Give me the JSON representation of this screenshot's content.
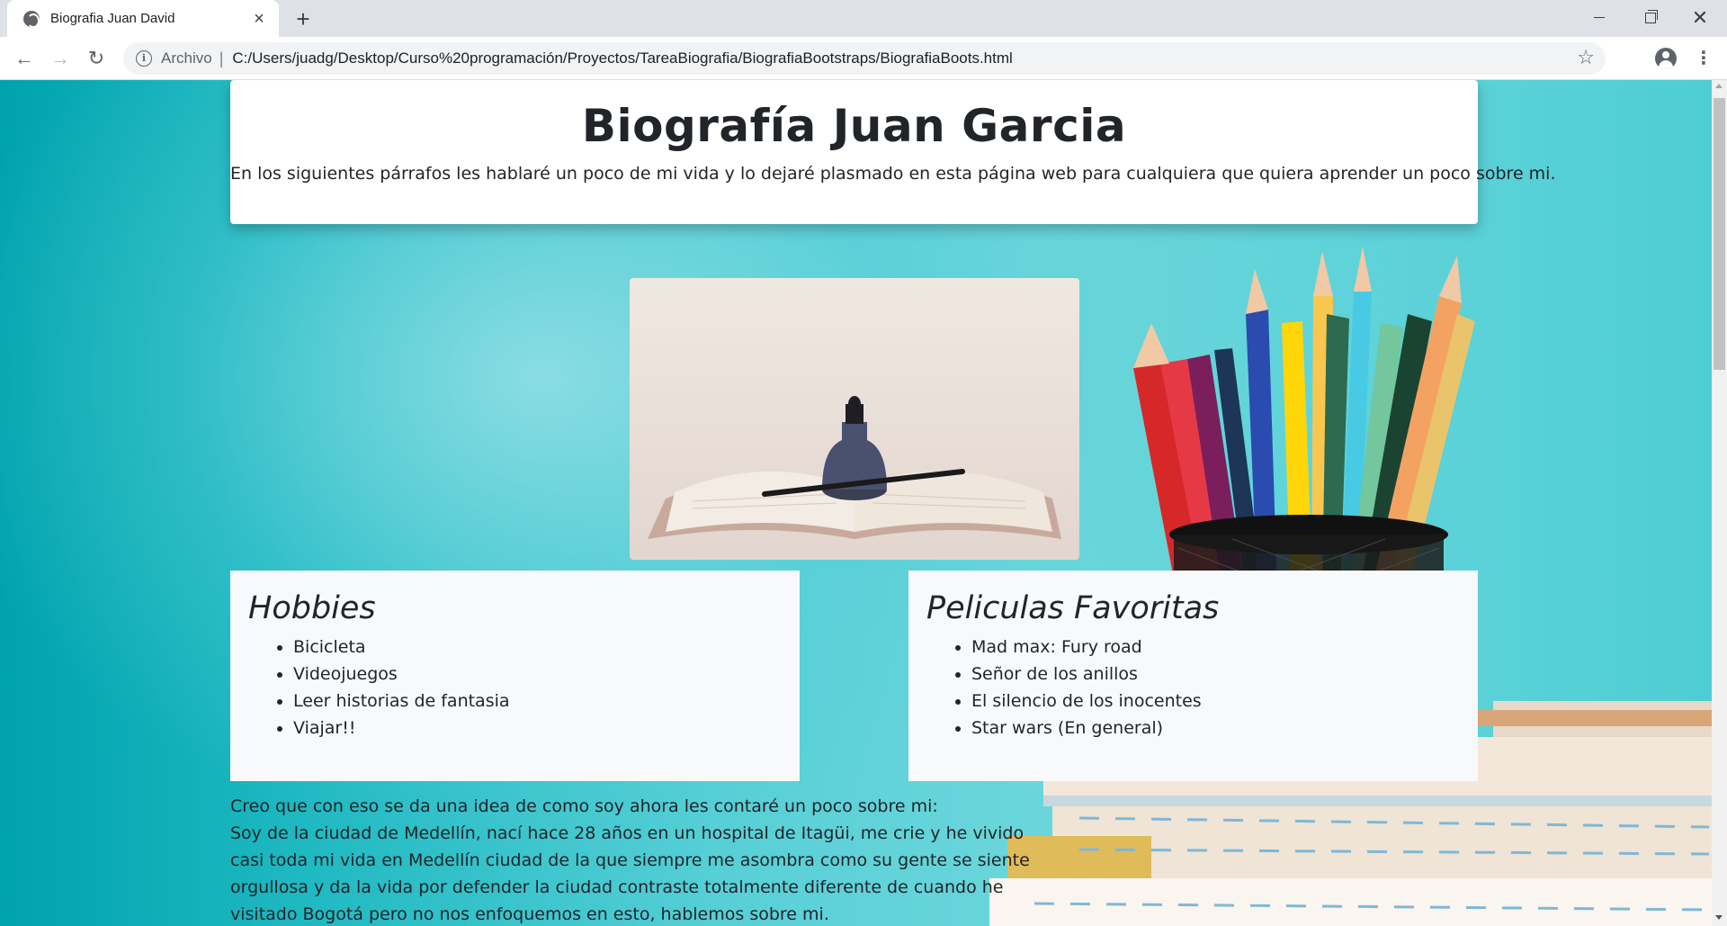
{
  "browser": {
    "tab_title": "Biografia Juan David",
    "tab_close_glyph": "×",
    "new_tab_glyph": "+",
    "window_close_glyph": "✕",
    "address_scheme_label": "Archivo",
    "address_separator": "|",
    "address_url": "C:/Users/juadg/Desktop/Curso%20programación/Proyectos/TareaBiografia/BiografiaBootstraps/BiografiaBoots.html",
    "back_glyph": "←",
    "forward_glyph": "→",
    "reload_glyph": "↻",
    "info_glyph": "i",
    "star_glyph": "☆",
    "menu_glyph": "⋮"
  },
  "page": {
    "title": "Biografía Juan Garcia",
    "intro": "En los siguientes párrafos les hablaré un poco de mi vida y lo dejaré plasmado en esta página web para cualquiera que quiera aprender un poco sobre mi.",
    "hobbies": {
      "heading": "Hobbies",
      "items": [
        "Bicicleta",
        "Videojuegos",
        "Leer historias de fantasia",
        "Viajar!!"
      ]
    },
    "movies": {
      "heading": "Peliculas Favoritas",
      "items": [
        "Mad max: Fury road",
        "Señor de los anillos",
        "El silencio de los inocentes",
        "Star wars (En general)"
      ]
    },
    "paragraph_line1": "Creo que con eso se da una idea de como soy ahora les contaré un poco sobre mi:",
    "paragraph_line2": "Soy de la ciudad de Medellín, nací hace 28 años en un hospital de Itagüi, me crie y he vivido casi toda mi vida en Medellín ciudad de la que siempre me asombra como su gente se siente orgullosa y da la vida por defender la ciudad contraste totalmente diferente de cuando he visitado Bogotá pero no nos enfoquemos en esto, hablemos sobre mi."
  },
  "colors": {
    "background_teal": "#1fb9c2",
    "card_white": "#ffffff",
    "card_light": "#f8f9fa",
    "text_dark": "#212529"
  },
  "icons": {
    "tab_favicon": "globe-icon",
    "info": "info-icon",
    "bookmark": "star-icon",
    "profile": "account-icon",
    "menu": "kebab-menu-icon"
  }
}
